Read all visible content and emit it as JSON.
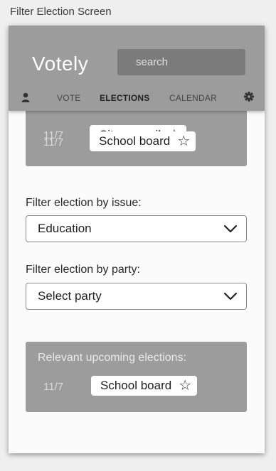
{
  "screen_title": "Filter Election Screen",
  "header": {
    "logo": "Votely",
    "search_placeholder": "search",
    "nav": {
      "vote": "VOTE",
      "elections": "ELECTIONS",
      "calendar": "CALENDAR"
    }
  },
  "saved_elections": [
    {
      "date": "11/7",
      "name": "City council"
    },
    {
      "date": "11/7",
      "name": "School board"
    }
  ],
  "filters": {
    "issue_label": "Filter election by issue:",
    "issue_value": "Education",
    "party_label": "Filter election by party:",
    "party_value": "Select party"
  },
  "relevant": {
    "heading": "Relevant upcoming elections:",
    "items": [
      {
        "date": "11/7",
        "name": "School board"
      }
    ]
  },
  "colors": {
    "header": "#9c9c9c",
    "search": "#7b7b7b",
    "card": "#9c9c9c"
  },
  "icons": {
    "user": "user-icon",
    "settings": "gear-icon",
    "favorite": "star-outline-icon",
    "dropdown": "chevron-down-icon"
  }
}
